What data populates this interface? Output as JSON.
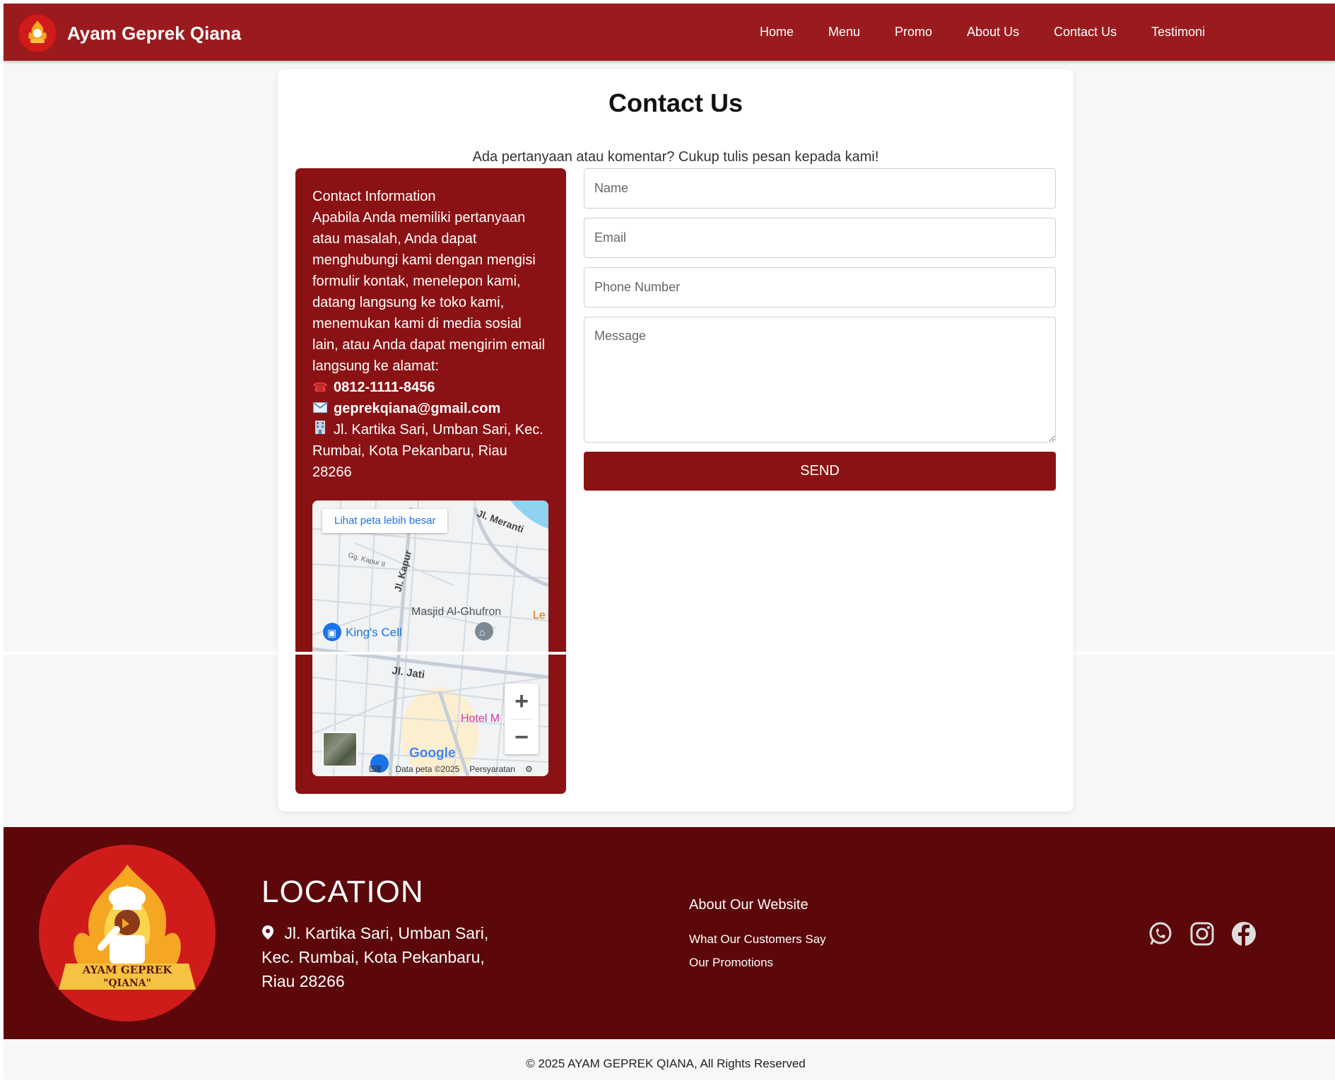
{
  "brand": {
    "name": "Ayam Geprek Qiana"
  },
  "nav": {
    "items": [
      "Home",
      "Menu",
      "Promo",
      "About Us",
      "Contact Us",
      "Testimoni"
    ]
  },
  "contact": {
    "title": "Contact Us",
    "subtitle": "Ada pertanyaan atau komentar? Cukup tulis pesan kepada kami!",
    "info_heading": "Contact Information",
    "info_body": "Apabila Anda memiliki pertanyaan atau masalah, Anda dapat menghubungi kami dengan mengisi formulir kontak, menelepon kami, datang langsung ke toko kami, menemukan kami di media sosial lain, atau Anda dapat mengirim email langsung ke alamat:",
    "phone": "0812-1111-8456",
    "email": "geprekqiana@gmail.com",
    "address": "Jl. Kartika Sari, Umban Sari, Kec. Rumbai, Kota Pekanbaru, Riau 28266"
  },
  "map": {
    "view_larger": "Lihat peta lebih besar",
    "labels": {
      "meranti": "Jl. Meranti",
      "kapur": "Jl. Kapur",
      "kapur2": "Gg. Kapur II",
      "masjid": "Masjid Al-Ghufron",
      "kings_cell": "King's Cell",
      "jati": "Jl. Jati",
      "hotel": "Hotel M",
      "google": "Google",
      "data": "Data peta ©2025",
      "terms": "Persyaratan"
    }
  },
  "form": {
    "name_placeholder": "Name",
    "email_placeholder": "Email",
    "phone_placeholder": "Phone Number",
    "message_placeholder": "Message",
    "send_label": "SEND"
  },
  "footer": {
    "location_title": "LOCATION",
    "location_address": "Jl. Kartika Sari, Umban Sari, Kec. Rumbai, Kota Pekanbaru, Riau 28266",
    "logo_text_1": "AYAM GEPREK",
    "logo_text_2": "\"QIANA\"",
    "about_title": "About Our Website",
    "links": [
      "What Our Customers Say",
      "Our Promotions"
    ],
    "social": [
      "whatsapp-icon",
      "instagram-icon",
      "facebook-icon"
    ],
    "copyright": "© 2025 AYAM GEPREK QIANA, All Rights Reserved"
  },
  "colors": {
    "nav_bg": "#9a1b1e",
    "panel_bg": "#8b1214",
    "footer_bg": "#5c0709",
    "logo_red": "#d01b1b"
  }
}
